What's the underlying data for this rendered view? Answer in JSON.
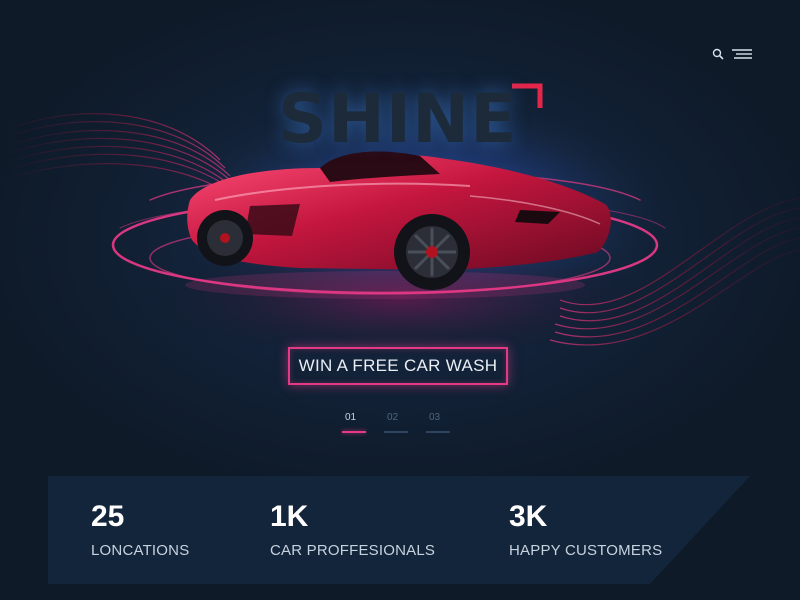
{
  "header": {
    "search_icon": "search-icon",
    "menu_icon": "hamburger-menu-icon"
  },
  "hero": {
    "brand": "SHINE",
    "cta_label": "WIN A FREE CAR WASH",
    "accent_color": "#e43a86",
    "glow_color": "#3a6fd8"
  },
  "pager": {
    "items": [
      {
        "label": "01",
        "active": true
      },
      {
        "label": "02",
        "active": false
      },
      {
        "label": "03",
        "active": false
      }
    ]
  },
  "stats": {
    "items": [
      {
        "value": "25",
        "label": "LONCATIONS"
      },
      {
        "value": "1K",
        "label": "CAR PROFFESIONALS"
      },
      {
        "value": "3K",
        "label": "HAPPY CUSTOMERS"
      }
    ]
  }
}
